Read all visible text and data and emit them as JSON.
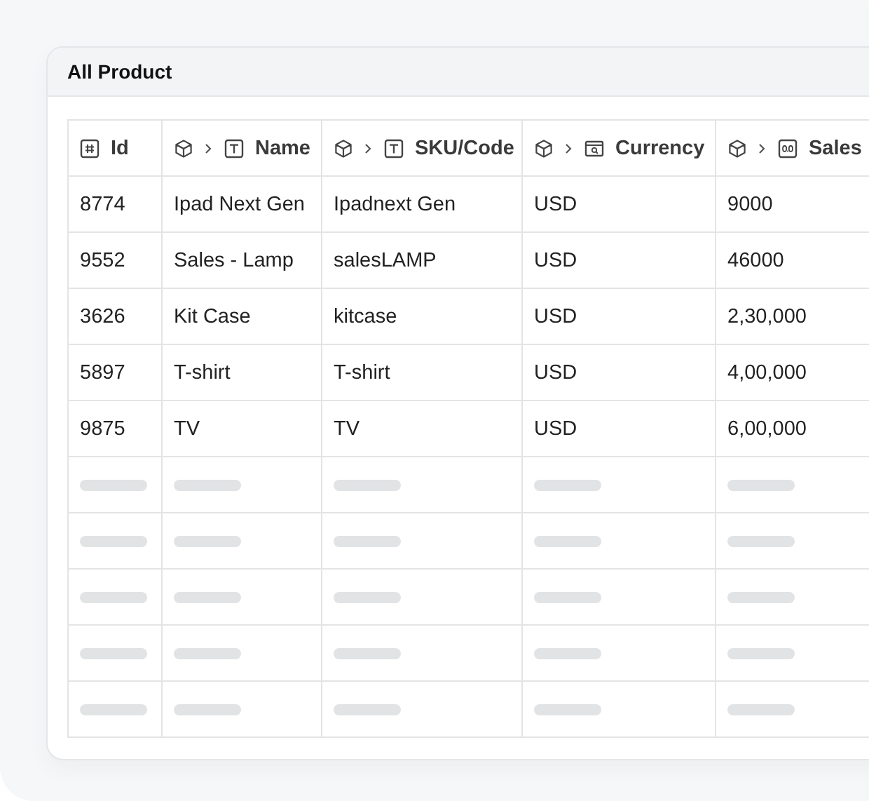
{
  "card": {
    "title": "All Product"
  },
  "table": {
    "columns": [
      {
        "label": "Id",
        "kind": "number",
        "linked": false
      },
      {
        "label": "Name",
        "kind": "text",
        "linked": true
      },
      {
        "label": "SKU/Code",
        "kind": "text",
        "linked": true
      },
      {
        "label": "Currency",
        "kind": "select",
        "linked": true
      },
      {
        "label": "Sales",
        "kind": "decimal",
        "linked": true
      }
    ],
    "rows": [
      {
        "kind": "data",
        "cells": [
          "8774",
          "Ipad Next Gen",
          "Ipadnext Gen",
          "USD",
          "9000"
        ]
      },
      {
        "kind": "data",
        "cells": [
          "9552",
          "Sales - Lamp",
          "salesLAMP",
          "USD",
          "46000"
        ]
      },
      {
        "kind": "data",
        "cells": [
          "3626",
          "Kit Case",
          "kitcase",
          "USD",
          "2,30,000"
        ]
      },
      {
        "kind": "data",
        "cells": [
          "5897",
          "T-shirt",
          "T-shirt",
          "USD",
          "4,00,000"
        ]
      },
      {
        "kind": "data",
        "cells": [
          "9875",
          "TV",
          "TV",
          "USD",
          "6,00,000"
        ]
      },
      {
        "kind": "skeleton"
      },
      {
        "kind": "skeleton"
      },
      {
        "kind": "skeleton"
      },
      {
        "kind": "skeleton"
      },
      {
        "kind": "skeleton"
      }
    ]
  }
}
